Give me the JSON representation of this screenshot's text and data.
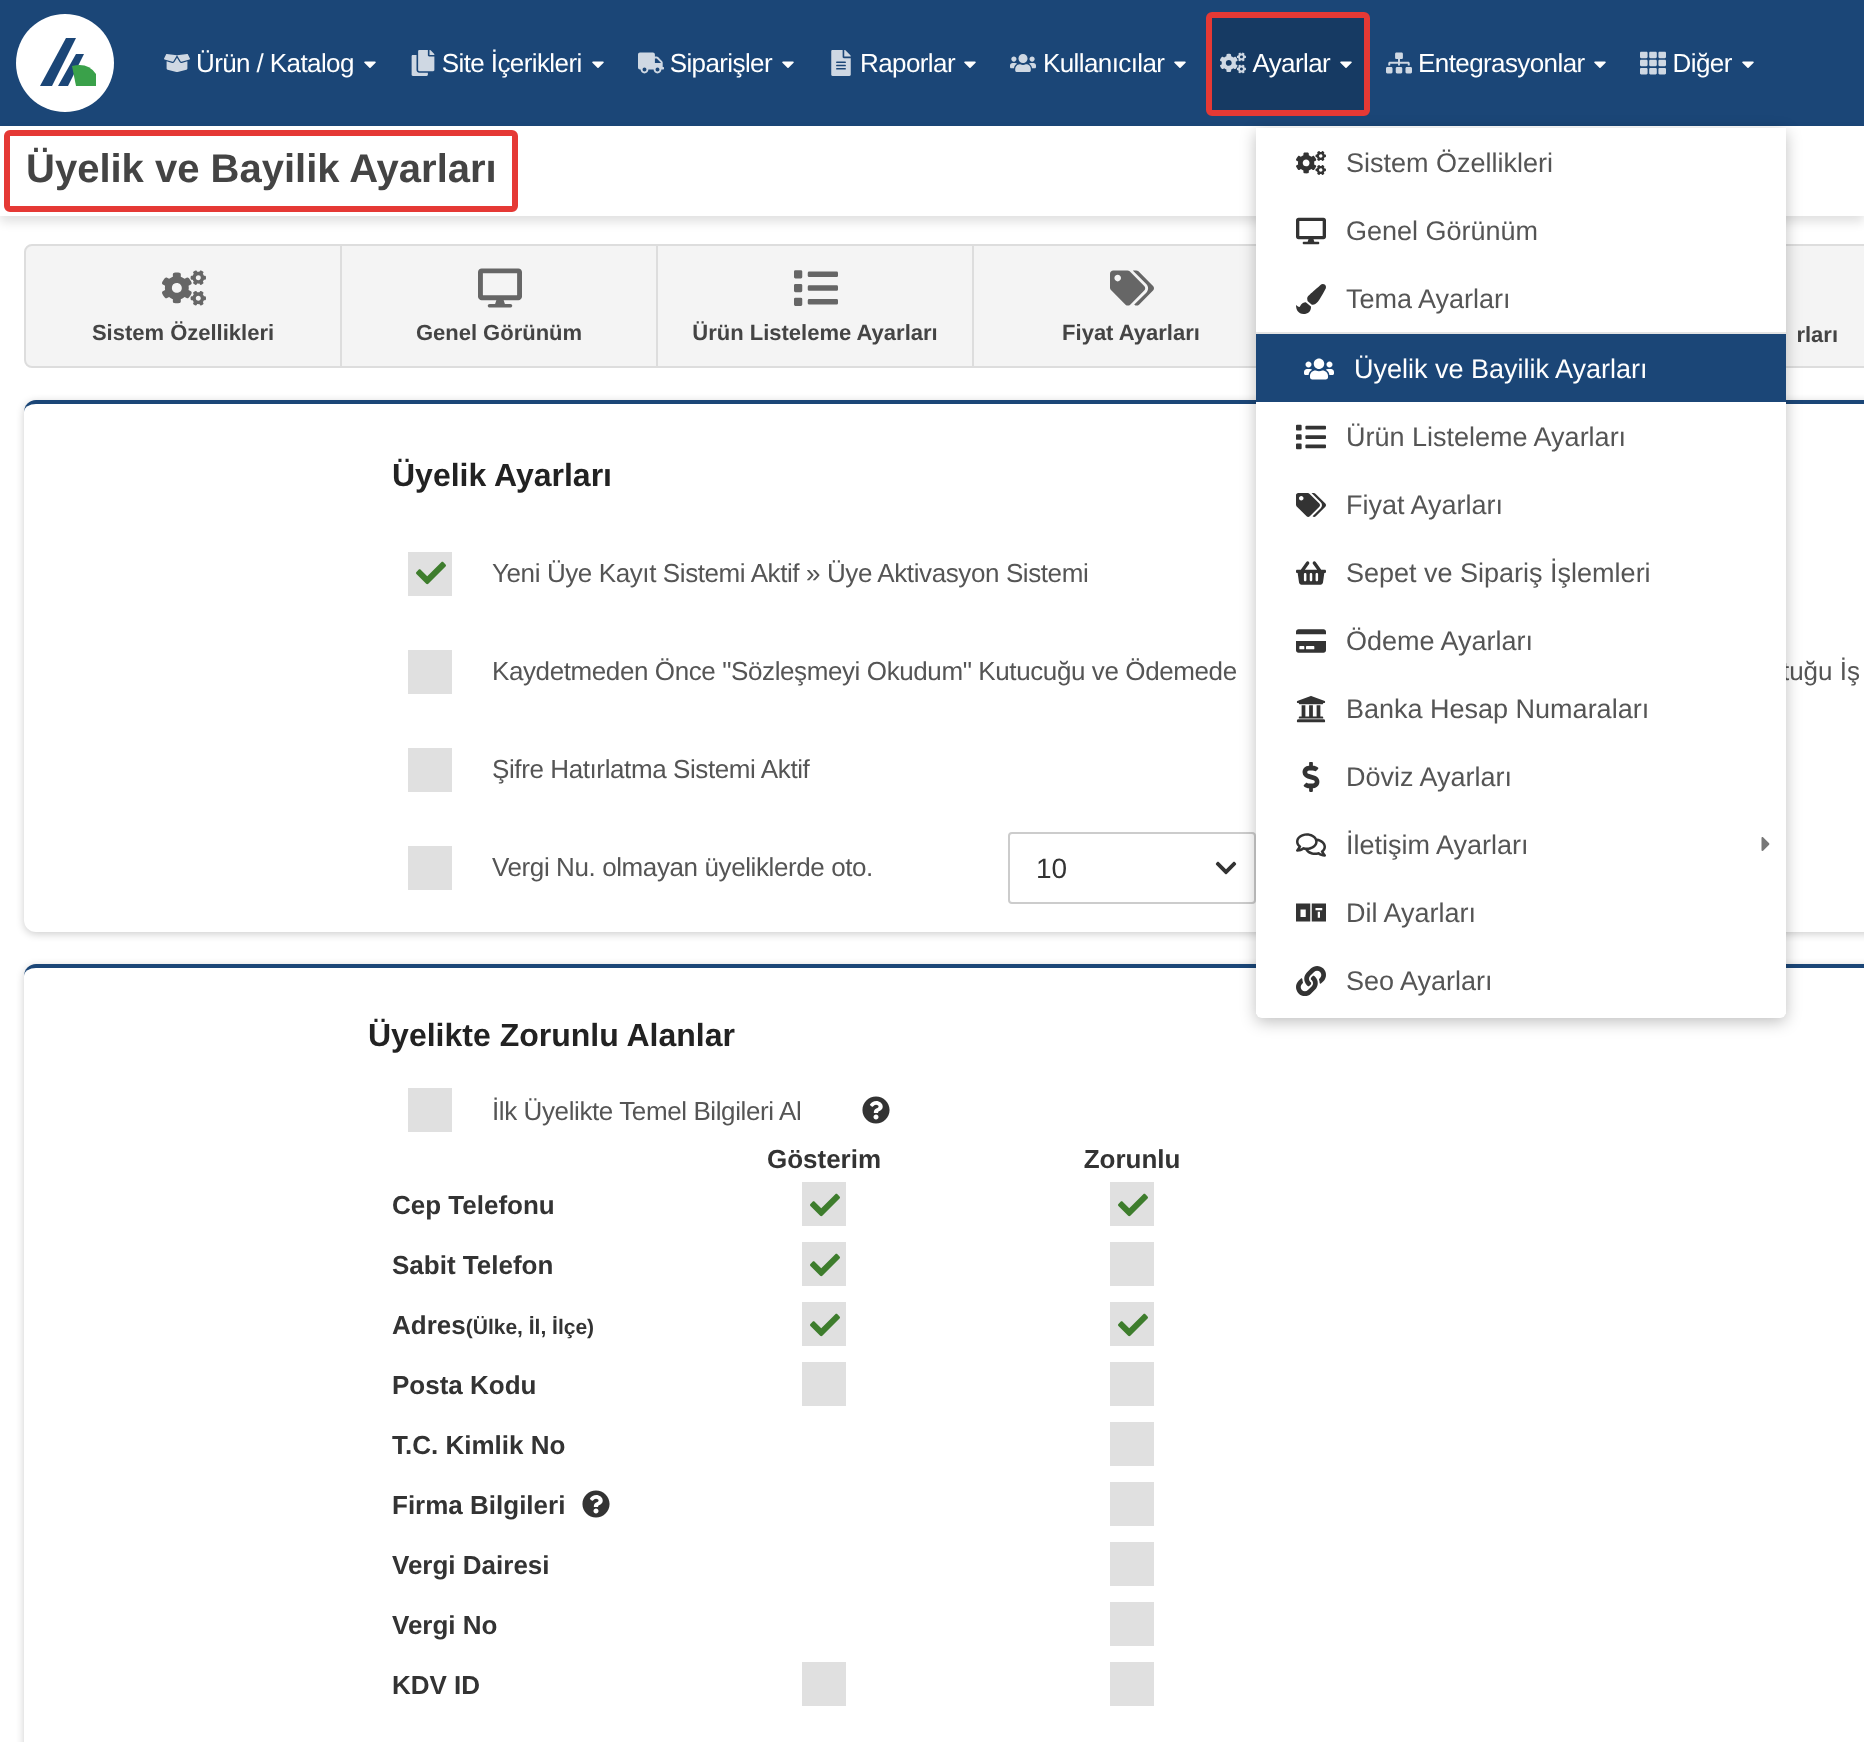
{
  "navbar": {
    "items": [
      {
        "label": "Ürün / Katalog",
        "highlighted": false
      },
      {
        "label": "Site İçerikleri",
        "highlighted": false
      },
      {
        "label": "Siparişler",
        "highlighted": false
      },
      {
        "label": "Raporlar",
        "highlighted": false
      },
      {
        "label": "Kullanıcılar",
        "highlighted": false
      },
      {
        "label": "Ayarlar",
        "highlighted": true
      },
      {
        "label": "Entegrasyonlar",
        "highlighted": false
      },
      {
        "label": "Diğer",
        "highlighted": false
      }
    ]
  },
  "page_title": {
    "text": "Üyelik ve Bayilik Ayarları",
    "highlighted": true
  },
  "settings_tabs": [
    {
      "label": "Sistem Özellikleri"
    },
    {
      "label": "Genel Görünüm"
    },
    {
      "label": "Ürün Listeleme Ayarları"
    },
    {
      "label": "Fiyat Ayarları"
    }
  ],
  "settings_tab_fragment": "rları",
  "membership": {
    "title": "Üyelik Ayarları",
    "options": [
      {
        "kind": "checkbox",
        "label": "Yeni Üye Kayıt Sistemi Aktif » Üye Aktivasyon Sistemi",
        "checked": true
      },
      {
        "kind": "checkbox",
        "label": "Kaydetmeden Önce \"Sözleşmeyi Okudum\" Kutucuğu ve Ödemede",
        "trailing": "tuğu İş",
        "checked": false
      },
      {
        "kind": "checkbox",
        "label": "Şifre Hatırlatma Sistemi Aktif",
        "checked": false
      },
      {
        "kind": "select",
        "label": "Vergi Nu. olmayan üyeliklerde oto.",
        "value": "10",
        "checked": false
      }
    ]
  },
  "required_fields": {
    "title": "Üyelikte Zorunlu Alanlar",
    "basic_info": {
      "label": "İlk Üyelikte Temel Bilgileri Al",
      "checked": false
    },
    "columns": [
      "Gösterim",
      "Zorunlu"
    ],
    "rows": [
      {
        "label": "Cep Telefonu",
        "show": true,
        "required": true
      },
      {
        "label": "Sabit Telefon",
        "show": true,
        "required": false
      },
      {
        "label": "Adres",
        "note": "(Ülke, İl, İlçe)",
        "show": true,
        "required": true
      },
      {
        "label": "Posta Kodu",
        "show": false,
        "required": false
      },
      {
        "label": "T.C. Kimlik No",
        "required": false
      },
      {
        "label": "Firma Bilgileri",
        "help": true,
        "required": false
      },
      {
        "label": "Vergi Dairesi",
        "required": false
      },
      {
        "label": "Vergi No",
        "required": false
      },
      {
        "label": "KDV ID",
        "show": false,
        "required": false
      }
    ]
  },
  "dropdown_menu": {
    "items": [
      {
        "label": "Sistem Özellikleri",
        "selected": false
      },
      {
        "label": "Genel Görünüm",
        "selected": false
      },
      {
        "label": "Tema Ayarları",
        "selected": false,
        "divider_after": true
      },
      {
        "label": "Üyelik ve Bayilik Ayarları",
        "selected": true
      },
      {
        "label": "Ürün Listeleme Ayarları",
        "selected": false
      },
      {
        "label": "Fiyat Ayarları",
        "selected": false
      },
      {
        "label": "Sepet ve Sipariş İşlemleri",
        "selected": false
      },
      {
        "label": "Ödeme Ayarları",
        "selected": false
      },
      {
        "label": "Banka Hesap Numaraları",
        "selected": false
      },
      {
        "label": "Döviz Ayarları",
        "selected": false
      },
      {
        "label": "İletişim Ayarları",
        "selected": false,
        "has_submenu": true
      },
      {
        "label": "Dil Ayarları",
        "selected": false
      },
      {
        "label": "Seo Ayarları",
        "selected": false
      }
    ]
  }
}
